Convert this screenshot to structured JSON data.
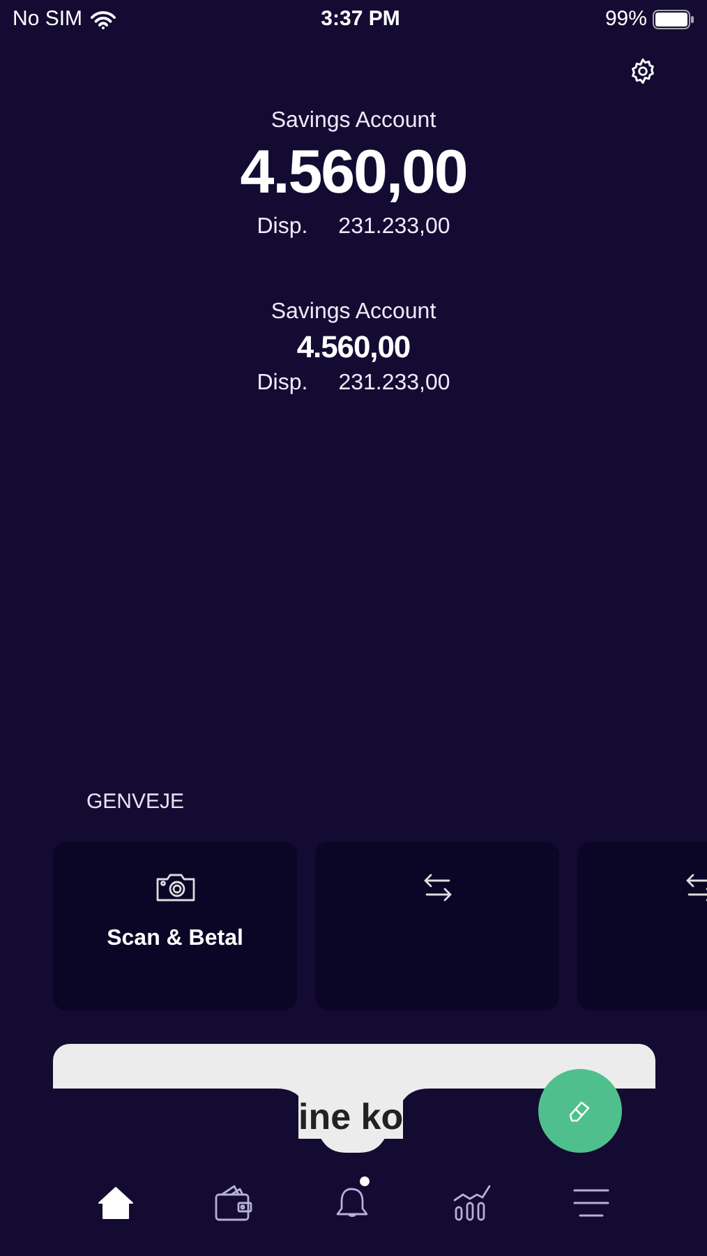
{
  "status_bar": {
    "carrier": "No SIM",
    "time": "3:37 PM",
    "battery": "99%"
  },
  "accounts": [
    {
      "kind": "primary",
      "name": "Savings Account",
      "balance": "4.560,00",
      "available_label": "Disp.",
      "available": "231.233,00"
    },
    {
      "kind": "secondary",
      "name": "Savings Account",
      "balance": "4.560,00",
      "available_label": "Disp.",
      "available": "231.233,00"
    }
  ],
  "shortcuts": {
    "title": "GENVEJE",
    "items": [
      {
        "kind": "camera",
        "label": "Scan & Betal"
      },
      {
        "kind": "transfer"
      },
      {
        "kind": "transfer"
      }
    ]
  },
  "card_peek": {
    "title": "ine ko"
  },
  "tab_bar": [
    {
      "kind": "home",
      "selected": true,
      "badge": false
    },
    {
      "kind": "wallet",
      "selected": false,
      "badge": false
    },
    {
      "kind": "bell",
      "selected": false,
      "badge": true
    },
    {
      "kind": "chart",
      "selected": false,
      "badge": false
    },
    {
      "kind": "menu",
      "selected": false,
      "badge": false
    }
  ]
}
